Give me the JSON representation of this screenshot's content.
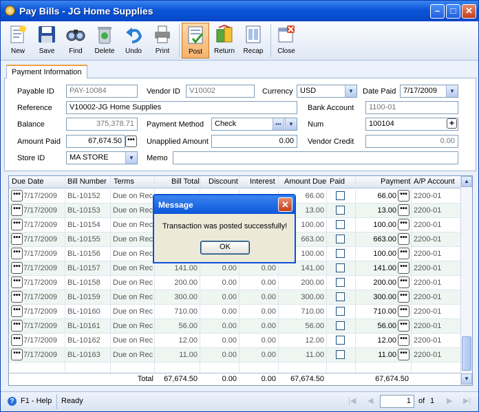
{
  "window": {
    "title": "Pay Bills - JG Home Supplies"
  },
  "toolbar": [
    {
      "label": "New",
      "icon": "new-icon"
    },
    {
      "label": "Save",
      "icon": "save-icon"
    },
    {
      "label": "Find",
      "icon": "find-icon"
    },
    {
      "label": "Delete",
      "icon": "delete-icon"
    },
    {
      "label": "Undo",
      "icon": "undo-icon"
    },
    {
      "label": "Print",
      "icon": "print-icon"
    },
    {
      "label": "Post",
      "icon": "post-icon"
    },
    {
      "label": "Return",
      "icon": "return-icon"
    },
    {
      "label": "Recap",
      "icon": "recap-icon"
    },
    {
      "label": "Close",
      "icon": "close-icon"
    }
  ],
  "tab": "Payment Information",
  "form": {
    "payable_id_label": "Payable ID",
    "payable_id": "PAY-10084",
    "vendor_id_label": "Vendor ID",
    "vendor_id": "V10002",
    "currency_label": "Currency",
    "currency": "USD",
    "date_paid_label": "Date Paid",
    "date_paid": "7/17/2009",
    "reference_label": "Reference",
    "reference": "V10002-JG Home Supplies",
    "bank_account_label": "Bank Account",
    "bank_account": "1100-01",
    "balance_label": "Balance",
    "balance": "375,378.71",
    "payment_method_label": "Payment Method",
    "payment_method": "Check",
    "num_label": "Num",
    "num": "100104",
    "amount_paid_label": "Amount Paid",
    "amount_paid": "67,674.50",
    "unapplied_label": "Unapplied Amount",
    "unapplied": "0.00",
    "vendor_credit_label": "Vendor Credit",
    "vendor_credit": "0.00",
    "store_id_label": "Store ID",
    "store_id": "MA STORE",
    "memo_label": "Memo",
    "memo": ""
  },
  "grid": {
    "headers": [
      "Due Date",
      "Bill Number",
      "Terms",
      "Bill Total",
      "Discount",
      "Interest",
      "Amount Due",
      "Paid",
      "Payment",
      "A/P Account"
    ],
    "rows": [
      {
        "date": "7/17/2009",
        "bill": "BL-10152",
        "terms": "Due on Rece",
        "total": "",
        "discount": "",
        "interest": "",
        "due": "66.00",
        "payment": "66.00",
        "ap": "2200-01"
      },
      {
        "date": "7/17/2009",
        "bill": "BL-10153",
        "terms": "Due on Rece",
        "total": "",
        "discount": "",
        "interest": "",
        "due": "13.00",
        "payment": "13.00",
        "ap": "2200-01"
      },
      {
        "date": "7/17/2009",
        "bill": "BL-10154",
        "terms": "Due on Rece",
        "total": "",
        "discount": "",
        "interest": "",
        "due": "100.00",
        "payment": "100.00",
        "ap": "2200-01"
      },
      {
        "date": "7/17/2009",
        "bill": "BL-10155",
        "terms": "Due on Rece",
        "total": "",
        "discount": "",
        "interest": "",
        "due": "663.00",
        "payment": "663.00",
        "ap": "2200-01"
      },
      {
        "date": "7/17/2009",
        "bill": "BL-10156",
        "terms": "Due on Rece",
        "total": "",
        "discount": "",
        "interest": "",
        "due": "100.00",
        "payment": "100.00",
        "ap": "2200-01"
      },
      {
        "date": "7/17/2009",
        "bill": "BL-10157",
        "terms": "Due on Rece",
        "total": "141.00",
        "discount": "0.00",
        "interest": "0.00",
        "due": "141.00",
        "payment": "141.00",
        "ap": "2200-01"
      },
      {
        "date": "7/17/2009",
        "bill": "BL-10158",
        "terms": "Due on Rece",
        "total": "200.00",
        "discount": "0.00",
        "interest": "0.00",
        "due": "200.00",
        "payment": "200.00",
        "ap": "2200-01"
      },
      {
        "date": "7/17/2009",
        "bill": "BL-10159",
        "terms": "Due on Rece",
        "total": "300.00",
        "discount": "0.00",
        "interest": "0.00",
        "due": "300.00",
        "payment": "300.00",
        "ap": "2200-01"
      },
      {
        "date": "7/17/2009",
        "bill": "BL-10160",
        "terms": "Due on Rece",
        "total": "710.00",
        "discount": "0.00",
        "interest": "0.00",
        "due": "710.00",
        "payment": "710.00",
        "ap": "2200-01"
      },
      {
        "date": "7/17/2009",
        "bill": "BL-10161",
        "terms": "Due on Rece",
        "total": "56.00",
        "discount": "0.00",
        "interest": "0.00",
        "due": "56.00",
        "payment": "56.00",
        "ap": "2200-01"
      },
      {
        "date": "7/17/2009",
        "bill": "BL-10162",
        "terms": "Due on Rece",
        "total": "12.00",
        "discount": "0.00",
        "interest": "0.00",
        "due": "12.00",
        "payment": "12.00",
        "ap": "2200-01"
      },
      {
        "date": "7/17/2009",
        "bill": "BL-10163",
        "terms": "Due on Rece",
        "total": "11.00",
        "discount": "0.00",
        "interest": "0.00",
        "due": "11.00",
        "payment": "11.00",
        "ap": "2200-01"
      }
    ],
    "totals": {
      "label": "Total",
      "total": "67,674.50",
      "discount": "0.00",
      "interest": "0.00",
      "due": "67,674.50",
      "payment": "67,674.50"
    }
  },
  "status": {
    "help": "F1 - Help",
    "state": "Ready",
    "page": "1",
    "of_label": "of",
    "page_count": "1"
  },
  "dialog": {
    "title": "Message",
    "message": "Transaction was posted successfully!",
    "ok": "OK"
  }
}
